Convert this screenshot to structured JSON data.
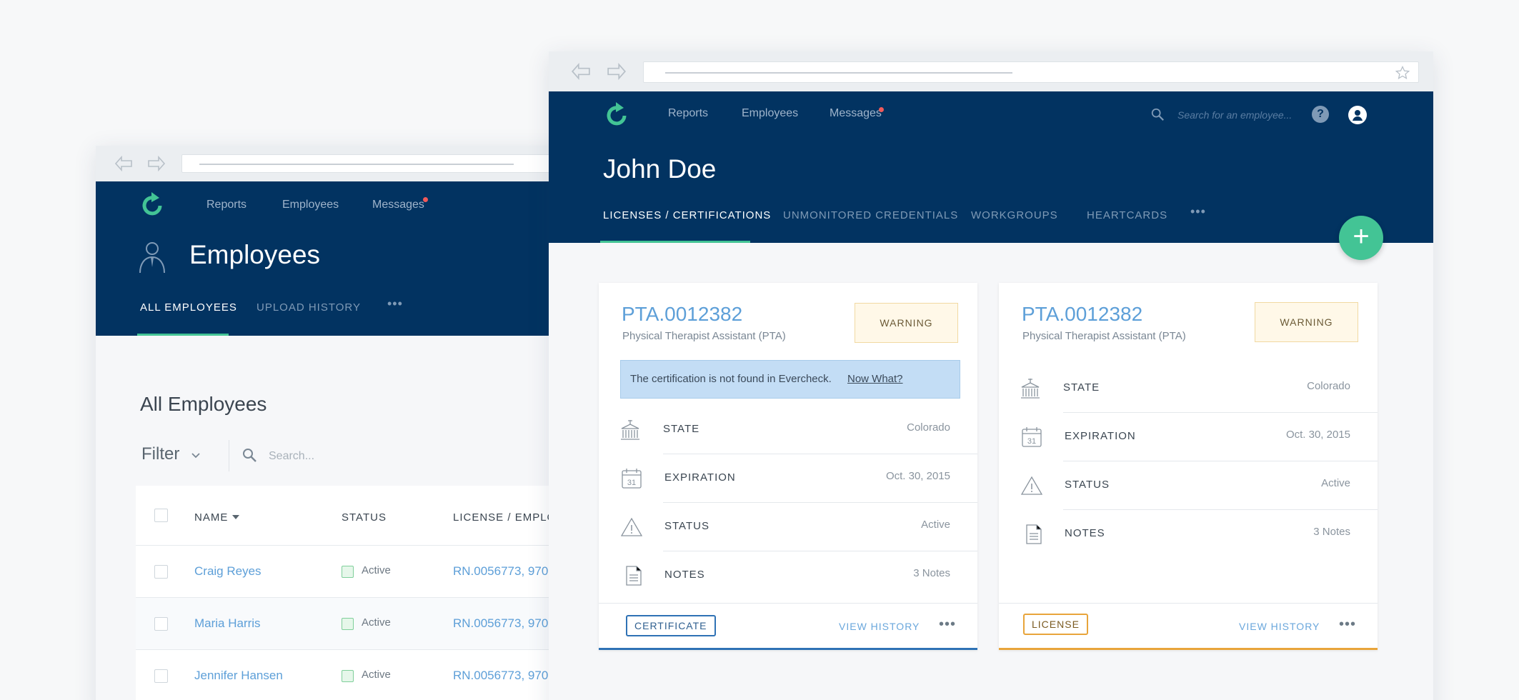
{
  "left_window": {
    "nav": {
      "reports": "Reports",
      "employees": "Employees",
      "messages": "Messages"
    },
    "page_title": "Employees",
    "tabs": [
      {
        "label": "ALL EMPLOYEES"
      },
      {
        "label": "UPLOAD HISTORY"
      }
    ],
    "more": "•••",
    "section_title": "All Employees",
    "filter_label": "Filter",
    "search_placeholder": "Search...",
    "columns": {
      "name": "NAME",
      "status": "STATUS",
      "license": "LICENSE / EMPLOY"
    },
    "rows": [
      {
        "name": "Craig Reyes",
        "status": "Active",
        "license": "RN.0056773, 970"
      },
      {
        "name": "Maria Harris",
        "status": "Active",
        "license": "RN.0056773, 970"
      },
      {
        "name": "Jennifer Hansen",
        "status": "Active",
        "license": "RN.0056773, 970"
      }
    ]
  },
  "right_window": {
    "nav": {
      "reports": "Reports",
      "employees": "Employees",
      "messages": "Messages"
    },
    "search_placeholder": "Search for an employee...",
    "help": "?",
    "person_name": "John Doe",
    "tabs": [
      {
        "label": "LICENSES / CERTIFICATIONS"
      },
      {
        "label": "UNMONITORED CREDENTIALS"
      },
      {
        "label": "WORKGROUPS"
      },
      {
        "label": "HEARTCARDS"
      }
    ],
    "more": "•••",
    "add": "+",
    "cards": [
      {
        "number": "PTA.0012382",
        "title": "Physical Therapist Assistant (PTA)",
        "badge": "WARNING",
        "alert_text": "The certification is not found in Evercheck.",
        "alert_link": "Now What?",
        "fields": [
          {
            "label": "STATE",
            "value": "Colorado"
          },
          {
            "label": "EXPIRATION",
            "value": "Oct. 30, 2015"
          },
          {
            "label": "STATUS",
            "value": "Active"
          },
          {
            "label": "NOTES",
            "value": "3 Notes"
          }
        ],
        "type_label": "CERTIFICATE",
        "view_history": "VIEW HISTORY",
        "more": "•••"
      },
      {
        "number": "PTA.0012382",
        "title": "Physical Therapist Assistant (PTA)",
        "badge": "WARNING",
        "fields": [
          {
            "label": "STATE",
            "value": "Colorado"
          },
          {
            "label": "EXPIRATION",
            "value": "Oct. 30, 2015"
          },
          {
            "label": "STATUS",
            "value": "Active"
          },
          {
            "label": "NOTES",
            "value": "3 Notes"
          }
        ],
        "type_label": "LICENSE",
        "view_history": "VIEW HISTORY",
        "more": "•••"
      }
    ]
  },
  "colors": {
    "navy": "#023361",
    "accent_green": "#43c495",
    "link_blue": "#5d9fd8",
    "certificate_blue": "#2f72b5",
    "license_orange": "#e8a43a",
    "warning_bg": "#fff8e8"
  }
}
